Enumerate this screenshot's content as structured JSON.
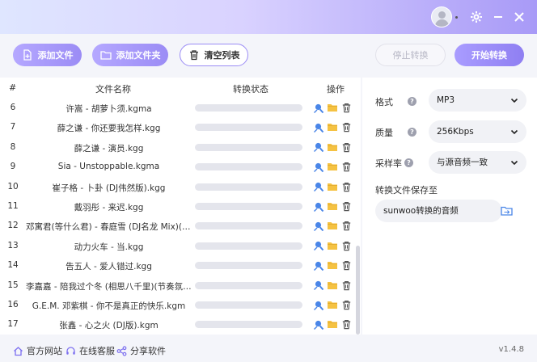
{
  "toolbar": {
    "add_file": "添加文件",
    "add_folder": "添加文件夹",
    "clear_list": "清空列表",
    "stop_convert": "停止转换",
    "start_convert": "开始转换"
  },
  "list": {
    "headers": {
      "index": "#",
      "name": "文件名称",
      "status": "转换状态",
      "actions": "操作"
    },
    "rows": [
      {
        "idx": "6",
        "name": "许嵩 - 胡萝卜须.kgma"
      },
      {
        "idx": "7",
        "name": "薛之谦 - 你还要我怎样.kgg"
      },
      {
        "idx": "8",
        "name": "薛之谦 - 演员.kgg"
      },
      {
        "idx": "9",
        "name": "Sia - Unstoppable.kgma"
      },
      {
        "idx": "10",
        "name": "崔子格 - 卜卦 (DJ伟然版).kgg"
      },
      {
        "idx": "11",
        "name": "戴羽彤 - 来迟.kgg"
      },
      {
        "idx": "12",
        "name": "邓寓君(等什么君) - 春庭雪 (DJ名龙 Mix)(DJ名..."
      },
      {
        "idx": "13",
        "name": "动力火车 - 当.kgg"
      },
      {
        "idx": "14",
        "name": "告五人 - 爱人错过.kgg"
      },
      {
        "idx": "15",
        "name": "李嘉嘉 - 陪我过个冬 (相思八千里)(节奏氛围版..."
      },
      {
        "idx": "16",
        "name": "G.E.M. 邓紫棋 - 你不是真正的快乐.kgm"
      },
      {
        "idx": "17",
        "name": "张鑫 - 心之火 (DJ版).kgm"
      }
    ]
  },
  "settings": {
    "format_label": "格式",
    "format_value": "MP3",
    "quality_label": "质量",
    "quality_value": "256Kbps",
    "samplerate_label": "采样率",
    "samplerate_value": "与源音频一致",
    "save_label": "转换文件保存至",
    "save_path": "sunwoo转换的音频"
  },
  "footer": {
    "website": "官方网站",
    "support": "在线客服",
    "share": "分享软件",
    "version": "v1.4.8"
  },
  "colors": {
    "accent": "#9b8cf5",
    "pin_blue": "#4a86e8",
    "folder_yellow": "#f5c242"
  }
}
